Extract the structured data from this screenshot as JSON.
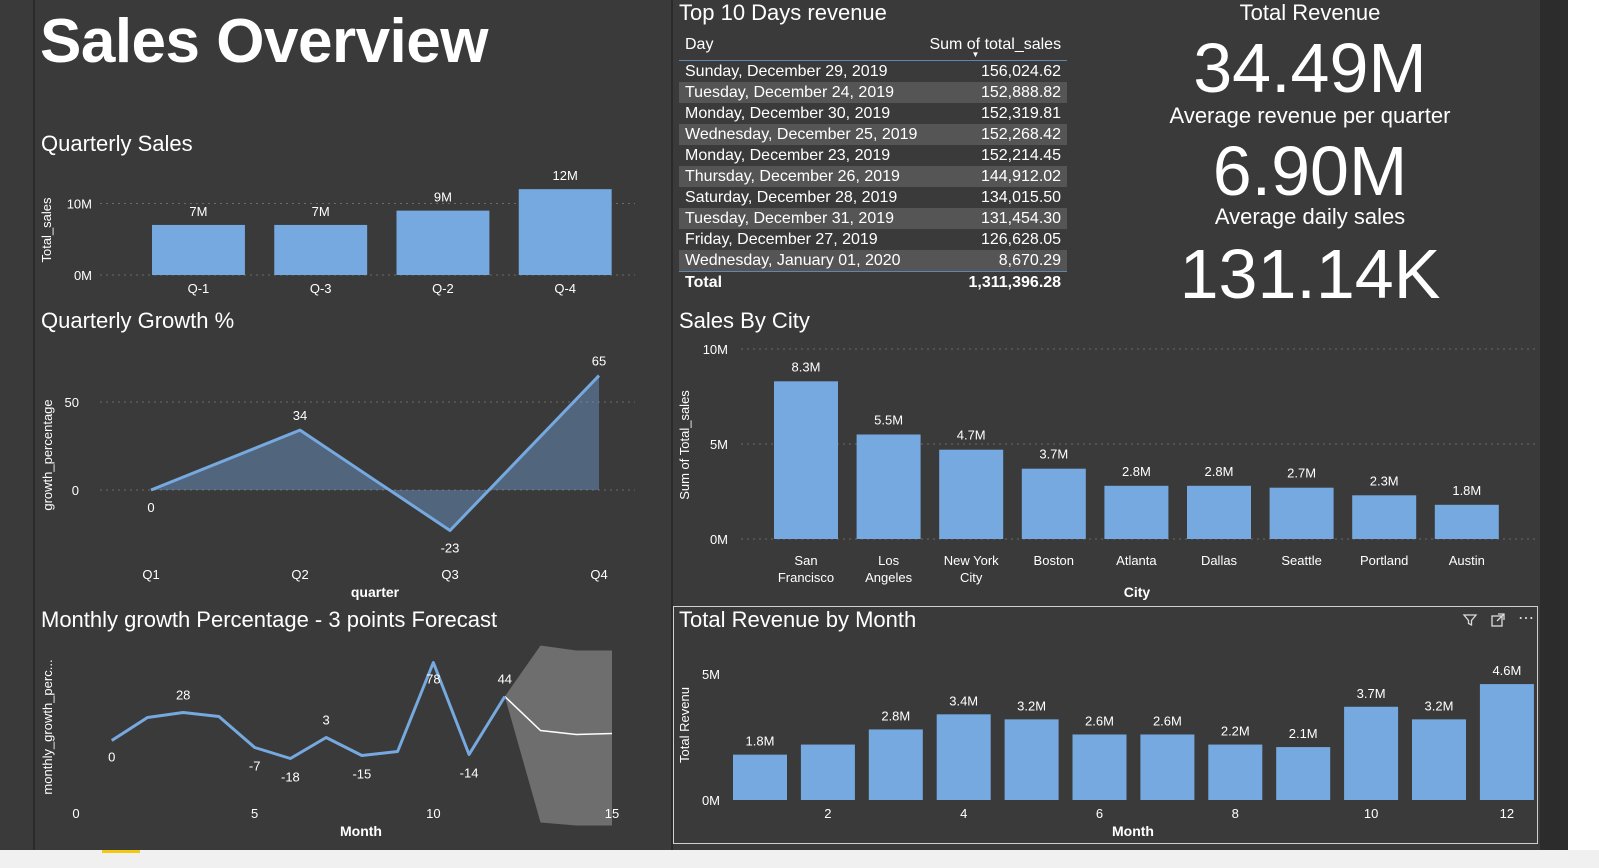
{
  "page": {
    "title": "Sales Overview"
  },
  "quarterly_sales": {
    "title": "Quarterly Sales",
    "chart_data": {
      "type": "bar",
      "categories": [
        "Q-1",
        "Q-3",
        "Q-2",
        "Q-4"
      ],
      "values": [
        7,
        7,
        9,
        12
      ],
      "data_labels": [
        "7M",
        "7M",
        "9M",
        "12M"
      ],
      "ylabel": "Total_sales",
      "yticks": [
        "0M",
        "10M"
      ],
      "ylim": [
        0,
        13
      ],
      "grid": true
    }
  },
  "quarterly_growth": {
    "title": "Quarterly Growth %",
    "chart_data": {
      "type": "area",
      "categories": [
        "Q1",
        "Q2",
        "Q3",
        "Q4"
      ],
      "values": [
        0,
        34,
        -23,
        65
      ],
      "data_labels": [
        "0",
        "34",
        "-23",
        "65"
      ],
      "xlabel": "quarter",
      "ylabel": "growth_percentage",
      "yticks": [
        "0",
        "50"
      ],
      "ylim": [
        -28,
        75
      ],
      "grid": true
    }
  },
  "monthly_growth": {
    "title": "Monthly growth Percentage - 3 points Forecast",
    "chart_data": {
      "type": "line",
      "x": [
        1,
        2,
        3,
        4,
        5,
        6,
        7,
        8,
        9,
        10,
        11,
        12
      ],
      "values": [
        0,
        23,
        28,
        24,
        -7,
        -18,
        3,
        -15,
        -11,
        78,
        -14,
        44
      ],
      "point_labels": [
        {
          "index": 0,
          "text": "0"
        },
        {
          "index": 2,
          "text": "28"
        },
        {
          "index": 4,
          "text": "-7"
        },
        {
          "index": 5,
          "text": "-18"
        },
        {
          "index": 6,
          "text": "3"
        },
        {
          "index": 7,
          "text": "-15"
        },
        {
          "index": 9,
          "text": "78"
        },
        {
          "index": 10,
          "text": "-14"
        },
        {
          "index": 11,
          "text": "44"
        }
      ],
      "forecast": {
        "x": [
          12,
          13,
          14,
          15
        ],
        "values": [
          44,
          10,
          6,
          7
        ],
        "upper": [
          44,
          95,
          90,
          90
        ],
        "lower": [
          44,
          -82,
          -85,
          -85
        ]
      },
      "xlabel": "Month",
      "ylabel": "monthly_growth_perc...",
      "xticks": [
        "0",
        "5",
        "10",
        "15"
      ],
      "xlim": [
        0,
        15
      ],
      "ylim": [
        -95,
        110
      ]
    }
  },
  "top10": {
    "title": "Top 10 Days revenue",
    "columns": [
      "Day",
      "Sum of total_sales"
    ],
    "rows": [
      [
        "Sunday, December 29, 2019",
        "156,024.62"
      ],
      [
        "Tuesday, December 24, 2019",
        "152,888.82"
      ],
      [
        "Monday, December 30, 2019",
        "152,319.81"
      ],
      [
        "Wednesday, December 25, 2019",
        "152,268.42"
      ],
      [
        "Monday, December 23, 2019",
        "152,214.45"
      ],
      [
        "Thursday, December 26, 2019",
        "144,912.02"
      ],
      [
        "Saturday, December 28, 2019",
        "134,015.50"
      ],
      [
        "Tuesday, December 31, 2019",
        "131,454.30"
      ],
      [
        "Friday, December 27, 2019",
        "126,628.05"
      ],
      [
        "Wednesday, January 01, 2020",
        "8,670.29"
      ]
    ],
    "total_label": "Total",
    "total_value": "1,311,396.28"
  },
  "kpis": {
    "total_revenue_label": "Total Revenue",
    "total_revenue_value": "34.49M",
    "avg_quarter_label": "Average revenue per quarter",
    "avg_quarter_value": "6.90M",
    "avg_daily_label": "Average daily sales",
    "avg_daily_value": "131.14K"
  },
  "sales_by_city": {
    "title": "Sales By City",
    "chart_data": {
      "type": "bar",
      "categories": [
        [
          "San",
          "Francisco"
        ],
        [
          "Los",
          "Angeles"
        ],
        [
          "New York",
          "City"
        ],
        [
          "Boston"
        ],
        [
          "Atlanta"
        ],
        [
          "Dallas"
        ],
        [
          "Seattle"
        ],
        [
          "Portland"
        ],
        [
          "Austin"
        ]
      ],
      "values": [
        8.3,
        5.5,
        4.7,
        3.7,
        2.8,
        2.8,
        2.7,
        2.3,
        1.8
      ],
      "data_labels": [
        "8.3M",
        "5.5M",
        "4.7M",
        "3.7M",
        "2.8M",
        "2.8M",
        "2.7M",
        "2.3M",
        "1.8M"
      ],
      "xlabel": "City",
      "ylabel": "Sum of Total_sales",
      "yticks": [
        "0M",
        "5M",
        "10M"
      ],
      "ylim": [
        0,
        10
      ],
      "grid": true
    }
  },
  "revenue_by_month": {
    "title": "Total Revenue by Month",
    "icons": [
      "filter-icon",
      "focus-mode-icon",
      "more-options-icon"
    ],
    "chart_data": {
      "type": "bar",
      "categories": [
        1,
        2,
        3,
        4,
        5,
        6,
        7,
        8,
        9,
        10,
        11,
        12
      ],
      "values": [
        1.8,
        2.2,
        2.8,
        3.4,
        3.2,
        2.6,
        2.6,
        2.2,
        2.1,
        3.7,
        3.2,
        4.6
      ],
      "data_labels": [
        "1.8M",
        "",
        "2.8M",
        "3.4M",
        "3.2M",
        "2.6M",
        "2.6M",
        "2.2M",
        "2.1M",
        "3.7M",
        "3.2M",
        "4.6M"
      ],
      "xlabel": "Month",
      "ylabel": "Total Revenu",
      "xticks": [
        "2",
        "4",
        "6",
        "8",
        "10",
        "12"
      ],
      "yticks": [
        "0M",
        "5M"
      ],
      "ylim": [
        0,
        5
      ]
    }
  }
}
